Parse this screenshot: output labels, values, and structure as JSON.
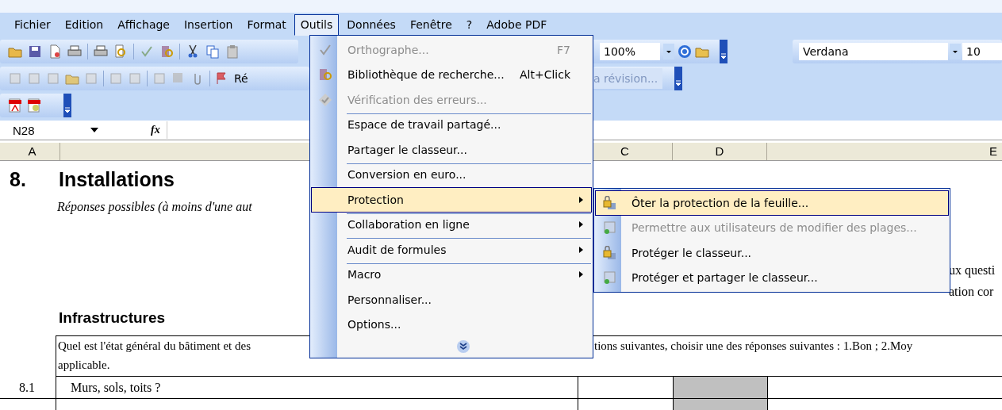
{
  "menubar": [
    {
      "label": "Fichier",
      "selected": false
    },
    {
      "label": "Edition",
      "selected": false
    },
    {
      "label": "Affichage",
      "selected": false
    },
    {
      "label": "Insertion",
      "selected": false
    },
    {
      "label": "Format",
      "selected": false
    },
    {
      "label": "Outils",
      "selected": true
    },
    {
      "label": "Données",
      "selected": false
    },
    {
      "label": "Fenêtre",
      "selected": false
    },
    {
      "label": "?",
      "selected": false
    },
    {
      "label": "Adobe PDF",
      "selected": false
    }
  ],
  "toolbar": {
    "partial_button": "Ré",
    "zoom": "100%",
    "review_button": "a révision...",
    "font": "Verdana",
    "font_size": "10"
  },
  "formula_bar": {
    "name_box": "N28",
    "fx": "fx"
  },
  "columns": [
    "A",
    "C",
    "D",
    "E"
  ],
  "sheet": {
    "section_number": "8.",
    "section_title": "Installations",
    "note": "Réponses possibles (à moins d'une aut",
    "right_text_1": "ux questi",
    "right_text_2": "ation cor",
    "subsection": "Infrastructures",
    "question_left": "Quel est l'état général du bâtiment et des",
    "question_right": "tions suivantes, choisir une des réponses suivantes : 1.Bon ; 2.Moy",
    "question_line2": "applicable.",
    "rows": [
      {
        "number": "8.1",
        "label": "Murs, sols, toits ?"
      }
    ]
  },
  "tools_menu": {
    "items": [
      {
        "label": "Orthographe...",
        "shortcut": "F7",
        "selected": false,
        "disabled": true,
        "submenu": false,
        "separator_before": false
      },
      {
        "label": "Bibliothèque de recherche...",
        "shortcut": "Alt+Click",
        "selected": false,
        "disabled": false,
        "submenu": false,
        "separator_before": false
      },
      {
        "label": "Vérification des erreurs...",
        "selected": false,
        "disabled": true,
        "submenu": false,
        "separator_before": false
      },
      {
        "label": "Espace de travail partagé...",
        "selected": false,
        "disabled": false,
        "submenu": false,
        "separator_before": true
      },
      {
        "label": "Partager le classeur...",
        "selected": false,
        "disabled": false,
        "submenu": false,
        "separator_before": false
      },
      {
        "label": "Conversion en euro...",
        "selected": false,
        "disabled": false,
        "submenu": false,
        "separator_before": true
      },
      {
        "label": "Protection",
        "selected": true,
        "disabled": false,
        "submenu": true,
        "separator_before": true
      },
      {
        "label": "Collaboration en ligne",
        "selected": false,
        "disabled": false,
        "submenu": true,
        "separator_before": true
      },
      {
        "label": "Audit de formules",
        "selected": false,
        "disabled": false,
        "submenu": true,
        "separator_before": true
      },
      {
        "label": "Macro",
        "selected": false,
        "disabled": false,
        "submenu": true,
        "separator_before": true
      },
      {
        "label": "Personnaliser...",
        "selected": false,
        "disabled": false,
        "submenu": false,
        "separator_before": false
      },
      {
        "label": "Options...",
        "selected": false,
        "disabled": false,
        "submenu": false,
        "separator_before": false
      }
    ]
  },
  "protection_submenu": {
    "items": [
      {
        "label": "Ôter la protection de la feuille...",
        "selected": true,
        "disabled": false
      },
      {
        "label": "Permettre aux utilisateurs de modifier des plages...",
        "selected": false,
        "disabled": true
      },
      {
        "label": "Protéger le classeur...",
        "selected": false,
        "disabled": false
      },
      {
        "label": "Protéger et partager le classeur...",
        "selected": false,
        "disabled": false
      }
    ]
  }
}
